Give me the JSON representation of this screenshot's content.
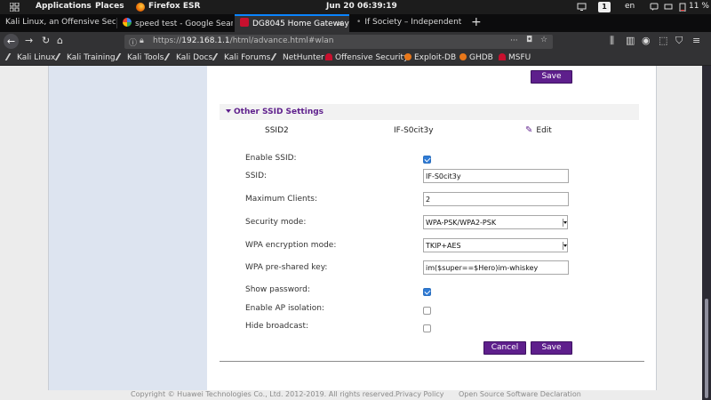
{
  "topbar": {
    "applications": "Applications",
    "places": "Places",
    "active_app": "Firefox ESR",
    "clock": "Jun 20  06:39:19",
    "workspace": "1",
    "language": "en",
    "battery": "11 %"
  },
  "tabs": [
    {
      "title": "Kali Linux, an Offensive Securi",
      "active": false
    },
    {
      "title": "speed test - Google Sear",
      "active": false
    },
    {
      "title": "DG8045 Home Gateway",
      "active": true
    },
    {
      "title": "If Society – Independent",
      "active": false
    }
  ],
  "navbar": {
    "url_host": "192.168.1.1",
    "url_scheme": "https://",
    "url_path": "/html/advance.html#wlan",
    "more": "···"
  },
  "bookmarks": [
    {
      "label": "Kali Linux",
      "icon": "kali-dragon-icon"
    },
    {
      "label": "Kali Training",
      "icon": "kali-dragon-icon"
    },
    {
      "label": "Kali Tools",
      "icon": "kali-dragon-icon"
    },
    {
      "label": "Kali Docs",
      "icon": "kali-dragon-icon"
    },
    {
      "label": "Kali Forums",
      "icon": "kali-dragon-icon"
    },
    {
      "label": "NetHunter",
      "icon": "kali-dragon-icon"
    },
    {
      "label": "Offensive Security",
      "icon": "offsec-icon"
    },
    {
      "label": "Exploit-DB",
      "icon": "exploitdb-icon"
    },
    {
      "label": "GHDB",
      "icon": "exploitdb-icon"
    },
    {
      "label": "MSFU",
      "icon": "offsec-icon"
    }
  ],
  "page": {
    "top_save_label": "Save",
    "section_title": "Other SSID Settings",
    "ssid_row": {
      "slot": "SSID2",
      "name": "IF-S0cit3y",
      "edit_label": "Edit"
    },
    "form": {
      "enable_ssid_label": "Enable SSID:",
      "enable_ssid_checked": true,
      "ssid_label": "SSID:",
      "ssid_value": "IF-S0cit3y",
      "max_clients_label": "Maximum Clients:",
      "max_clients_value": "2",
      "security_mode_label": "Security mode:",
      "security_mode_value": "WPA-PSK/WPA2-PSK",
      "wpa_encryption_label": "WPA encryption mode:",
      "wpa_encryption_value": "TKIP+AES",
      "psk_label": "WPA pre-shared key:",
      "psk_value": "im($super==$Hero)im-whiskey",
      "show_password_label": "Show password:",
      "show_password_checked": true,
      "ap_isolation_label": "Enable AP isolation:",
      "ap_isolation_checked": false,
      "hide_broadcast_label": "Hide broadcast:",
      "hide_broadcast_checked": false
    },
    "cancel_label": "Cancel",
    "save_label": "Save"
  },
  "footer": {
    "copyright": "Copyright © Huawei Technologies Co., Ltd. 2012-2019. All rights reserved.",
    "privacy": "Privacy Policy",
    "open_source": "Open Source Software Declaration"
  },
  "colors": {
    "accent_purple": "#5e1f8c",
    "checkbox_blue": "#2f7bd6",
    "firefox_active_tab": "#0a84ff"
  }
}
